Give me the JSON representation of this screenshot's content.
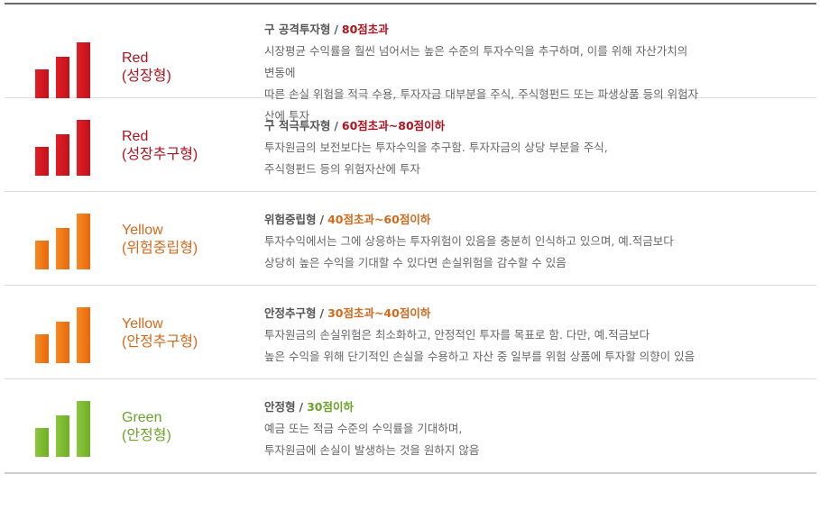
{
  "risk_types": [
    {
      "color_name": "Red",
      "type_label": "(성장형)",
      "heading": "구 공격투자형",
      "score": "80점초과",
      "desc_lines": [
        "시장평균 수익률을 훨씬 넘어서는 높은 수준의 투자수익을 추구하며, 이를 위해 자산가치의",
        "변동에",
        "따른 손실 위험을 적극 수용, 투자자금 대부분을 주식, 주식형펀드 또는 파생상품 등의 위험자",
        "산에 투자"
      ],
      "accent": "#b1121d",
      "icon": "bar-chart-icon"
    },
    {
      "color_name": "Red",
      "type_label": "(성장추구형)",
      "heading": "구 적극투자형",
      "score": "60점초과~80점이하",
      "desc_lines": [
        "투자원금의 보전보다는 투자수익을 추구함. 투자자금의 상당 부분을 주식,",
        "주식형펀드 등의 위험자산에 투자"
      ],
      "accent": "#b1121d",
      "icon": "bar-chart-icon"
    },
    {
      "color_name": "Yellow",
      "type_label": "(위험중립형)",
      "heading": "위험중립형",
      "score": "40점초과~60점이하",
      "desc_lines": [
        "투자수익에서는 그에 상응하는 투자위험이 있음을 충분히 인식하고 있으며, 예.적금보다",
        "상당히 높은 수익을 기대할 수 있다면 손실위험을 감수할 수 있음"
      ],
      "accent": "#d2691c",
      "icon": "bar-chart-icon"
    },
    {
      "color_name": "Yellow",
      "type_label": "(안정추구형)",
      "heading": "안정추구형",
      "score": "30점초과~40점이하",
      "desc_lines": [
        "투자원금의 손실위험은 최소화하고, 안정적인 투자를 목표로 함. 다만, 예.적금보다",
        "높은 수익을 위해 단기적인 손실을 수용하고 자산 중 일부를 위험 상품에 투자할 의향이 있음"
      ],
      "accent": "#d2691c",
      "icon": "bar-chart-icon"
    },
    {
      "color_name": "Green",
      "type_label": "(안정형)",
      "heading": "안정형",
      "score": "30점이하",
      "desc_lines": [
        "예금 또는 적금 수준의 수익률을 기대하며,",
        "투자원금에 손실이 발생하는 것을 원하지 않음"
      ],
      "accent": "#6ba32a",
      "icon": "bar-chart-icon"
    }
  ],
  "separator": "/"
}
